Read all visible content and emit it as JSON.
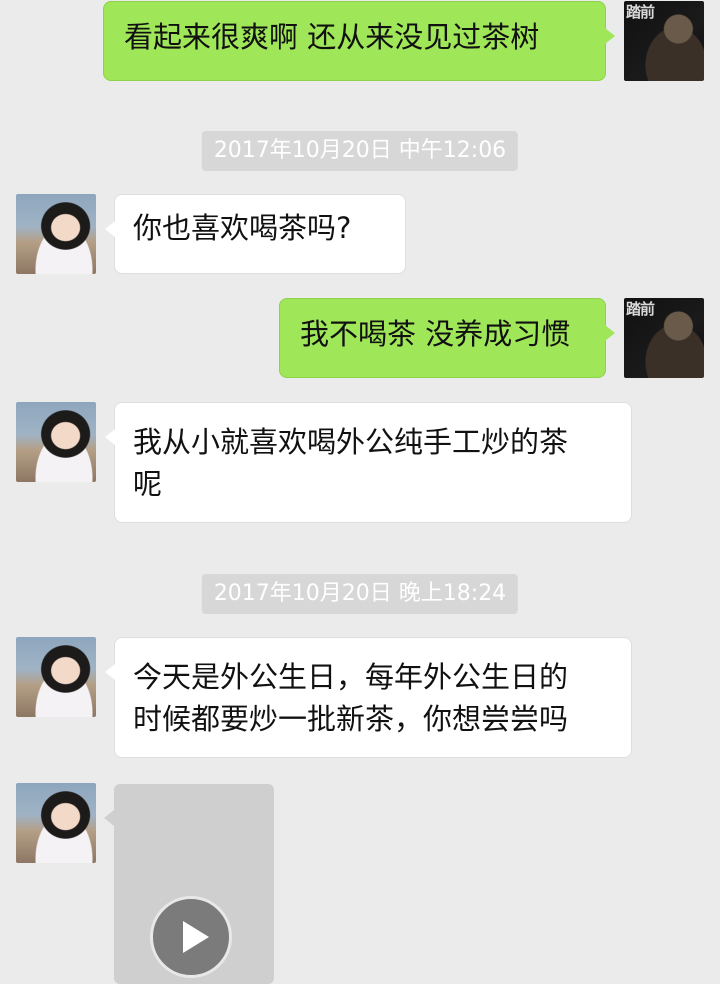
{
  "messages": [
    {
      "side": "right",
      "text": "看起来很爽啊  还从来没见过茶树"
    },
    {
      "type": "time",
      "text": "2017年10月20日 中午12:06"
    },
    {
      "side": "left",
      "text": "你也喜欢喝茶吗?"
    },
    {
      "side": "right",
      "text": "我不喝茶 没养成习惯"
    },
    {
      "side": "left",
      "line1": "我从小就喜欢喝外公纯手工炒的茶",
      "line2": "呢"
    },
    {
      "type": "time",
      "text": "2017年10月20日 晚上18:24"
    },
    {
      "side": "left",
      "line1": "今天是外公生日，每年外公生日的",
      "line2": "时候都要炒一批新茶，你想尝尝吗"
    },
    {
      "side": "left",
      "type": "video"
    }
  ],
  "avatars": {
    "self_glyph": "踏前",
    "self_icon": "man-portrait-avatar",
    "other_icon": "girl-portrait-avatar"
  },
  "colors": {
    "background": "#ebebeb",
    "sent_bubble": "#9fe658",
    "received_bubble": "#ffffff",
    "time_badge": "#d7d7d7"
  }
}
